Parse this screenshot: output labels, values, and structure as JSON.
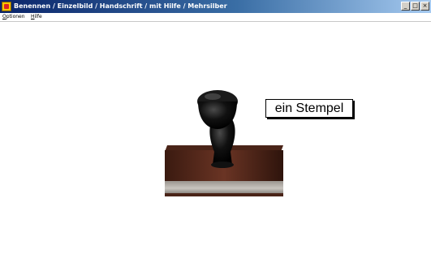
{
  "window": {
    "title": "Benennen / Einzelbild / Handschrift / mit Hilfe / Mehrsilber",
    "controls": {
      "minimize": "_",
      "maximize": "□",
      "close": "×"
    }
  },
  "menu": {
    "items": [
      {
        "label": "Optionen"
      },
      {
        "label": "Hilfe"
      }
    ]
  },
  "content": {
    "image": "rubber-stamp",
    "caption": "ein Stempel"
  }
}
